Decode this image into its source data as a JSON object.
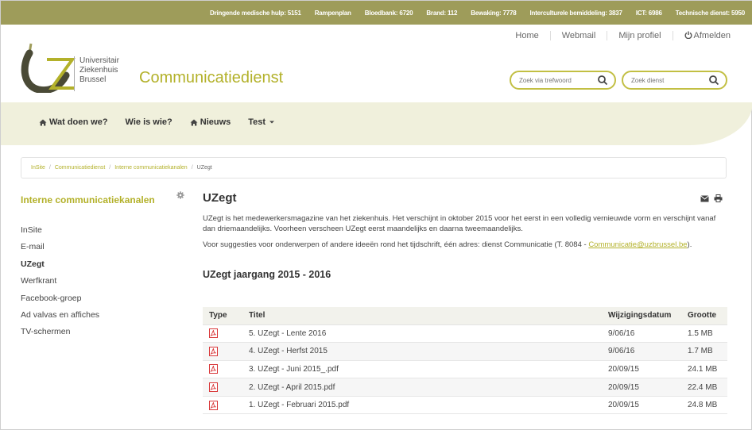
{
  "topbar": {
    "items": [
      "Dringende medische hulp: 5151",
      "Rampenplan",
      "Bloedbank: 6720",
      "Brand: 112",
      "Bewaking: 7778",
      "Interculturele bemiddeling: 3837",
      "ICT: 6986",
      "Technische dienst: 5950"
    ]
  },
  "header": {
    "logo_lines": [
      "Universitair",
      "Ziekenhuis",
      "Brussel"
    ],
    "site_title": "Communicatiedienst",
    "links": [
      "Home",
      "Webmail",
      "Mijn profiel",
      "Afmelden"
    ],
    "search_trefwoord_placeholder": "Zoek via trefwoord",
    "search_dienst_placeholder": "Zoek dienst"
  },
  "nav": {
    "items": [
      "Wat doen we?",
      "Wie is wie?",
      "Nieuws",
      "Test"
    ]
  },
  "breadcrumb": {
    "items": [
      "InSite",
      "Communicatiedienst",
      "Interne communicatiekanalen"
    ],
    "current": "UZegt",
    "separator": "/"
  },
  "sidebar": {
    "title": "Interne communicatiekanalen",
    "items": [
      "InSite",
      "E-mail",
      "UZegt",
      "Werfkrant",
      "Facebook-groep",
      "Ad valvas en affiches",
      "TV-schermen"
    ],
    "active_index": 2
  },
  "main": {
    "title": "UZegt",
    "paragraph1": "UZegt is het medewerkersmagazine van het ziekenhuis. Het verschijnt in oktober 2015 voor het eerst in een volledig vernieuwde vorm en verschijnt vanaf dan driemaandelijks. Voorheen verscheen UZegt eerst maandelijks en daarna tweemaandelijks.",
    "paragraph2_prefix": "Voor suggesties voor onderwerpen of andere ideeën rond het tijdschrift, één adres: dienst Communicatie (T. 8084 - ",
    "paragraph2_link": "Communicatie@uzbrussel.be",
    "paragraph2_suffix": ").",
    "subtitle": "UZegt jaargang 2015 - 2016"
  },
  "table": {
    "headers": [
      "Type",
      "Titel",
      "Wijzigingsdatum",
      "Grootte"
    ],
    "rows": [
      {
        "title": "5. UZegt - Lente 2016",
        "date": "9/06/16",
        "size": "1.5 MB"
      },
      {
        "title": "4. UZegt - Herfst 2015",
        "date": "9/06/16",
        "size": "1.7 MB"
      },
      {
        "title": "3. UZegt - Juni 2015_.pdf",
        "date": "20/09/15",
        "size": "24.1 MB"
      },
      {
        "title": "2. UZegt - April 2015.pdf",
        "date": "20/09/15",
        "size": "22.4 MB"
      },
      {
        "title": "1. UZegt - Februari 2015.pdf",
        "date": "20/09/15",
        "size": "24.8 MB"
      }
    ]
  },
  "colors": {
    "topbar": "#9e9c5a",
    "accent": "#b3b12a",
    "nav_band": "#f0f0dc",
    "pdf_icon": "#d9383a"
  }
}
